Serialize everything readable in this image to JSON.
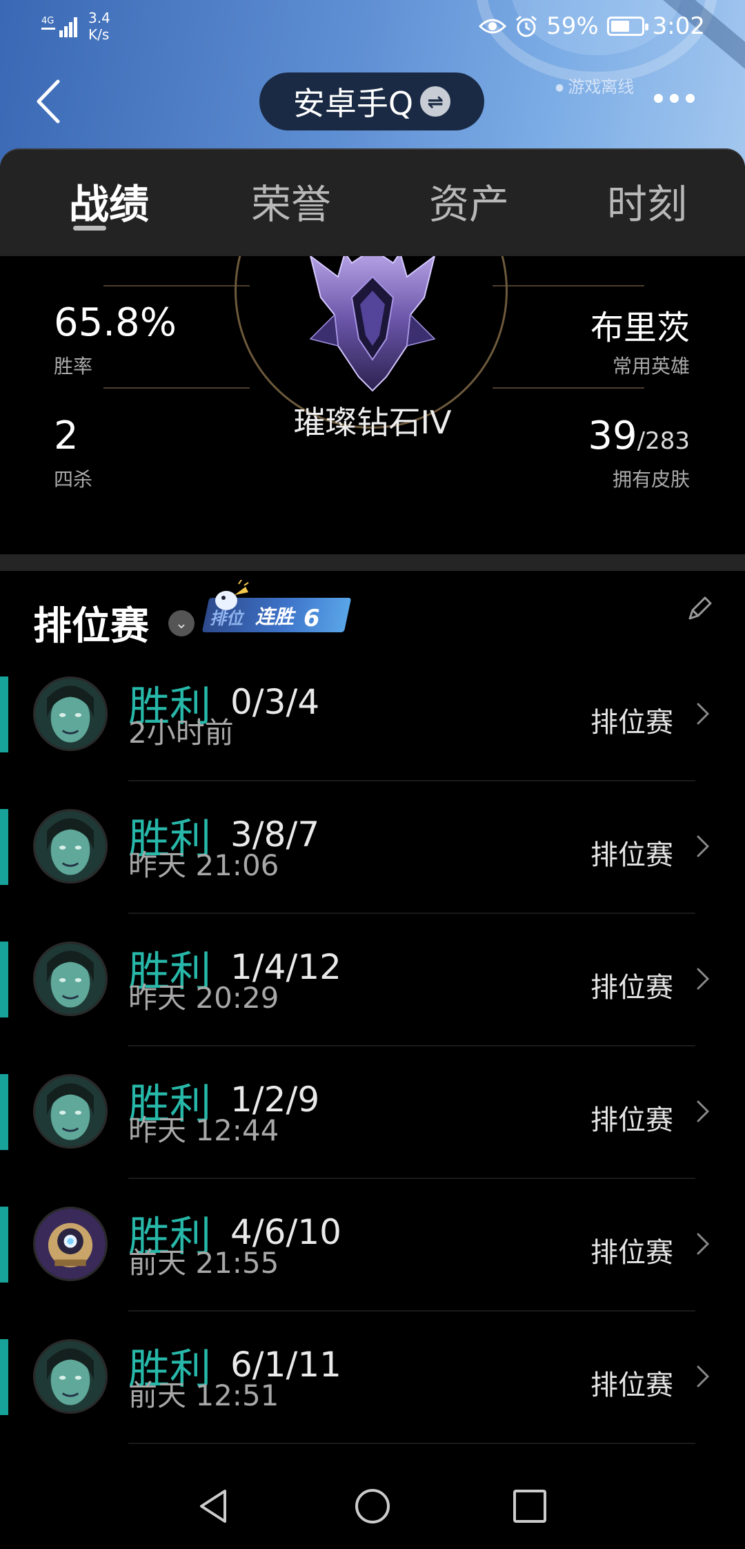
{
  "status_bar": {
    "network": "4G",
    "speed_value": "3.4",
    "speed_unit": "K/s",
    "battery": "59%",
    "time": "3:02"
  },
  "header": {
    "title": "安卓手Q",
    "status": "游戏离线"
  },
  "tabs": [
    {
      "label": "战绩",
      "active": true
    },
    {
      "label": "荣誉",
      "active": false
    },
    {
      "label": "资产",
      "active": false
    },
    {
      "label": "时刻",
      "active": false
    }
  ],
  "stats": {
    "rank_name": "璀璨钻石IV",
    "win_rate": {
      "value": "65.8%",
      "label": "胜率"
    },
    "quadra_kills": {
      "value": "2",
      "label": "四杀"
    },
    "favorite_champion": {
      "value": "布里茨",
      "label": "常用英雄"
    },
    "skins": {
      "owned": "39",
      "total": "/283",
      "label": "拥有皮肤"
    }
  },
  "ranked": {
    "title": "排位赛",
    "streak_tag": "排位",
    "streak_label": "连胜",
    "streak_count": "6"
  },
  "matches": [
    {
      "result": "胜利",
      "kda": "0/3/4",
      "time": "2小时前",
      "mode": "排位赛",
      "avatar": "teal"
    },
    {
      "result": "胜利",
      "kda": "3/8/7",
      "time": "昨天 21:06",
      "mode": "排位赛",
      "avatar": "teal"
    },
    {
      "result": "胜利",
      "kda": "1/4/12",
      "time": "昨天 20:29",
      "mode": "排位赛",
      "avatar": "teal"
    },
    {
      "result": "胜利",
      "kda": "1/2/9",
      "time": "昨天 12:44",
      "mode": "排位赛",
      "avatar": "teal"
    },
    {
      "result": "胜利",
      "kda": "4/6/10",
      "time": "前天 21:55",
      "mode": "排位赛",
      "avatar": "robot"
    },
    {
      "result": "胜利",
      "kda": "6/1/11",
      "time": "前天 12:51",
      "mode": "排位赛",
      "avatar": "teal"
    }
  ],
  "colors": {
    "win": "#27b8a9",
    "accent_bar": "#17a39a",
    "header_blue": "#4f7fc6"
  },
  "icons": [
    "back-icon",
    "switch-account-icon",
    "more-icon",
    "eye-icon",
    "alarm-icon",
    "battery-icon",
    "dropdown-icon",
    "edit-icon",
    "chevron-right-icon",
    "nav-back-icon",
    "nav-home-icon",
    "nav-recents-icon"
  ]
}
